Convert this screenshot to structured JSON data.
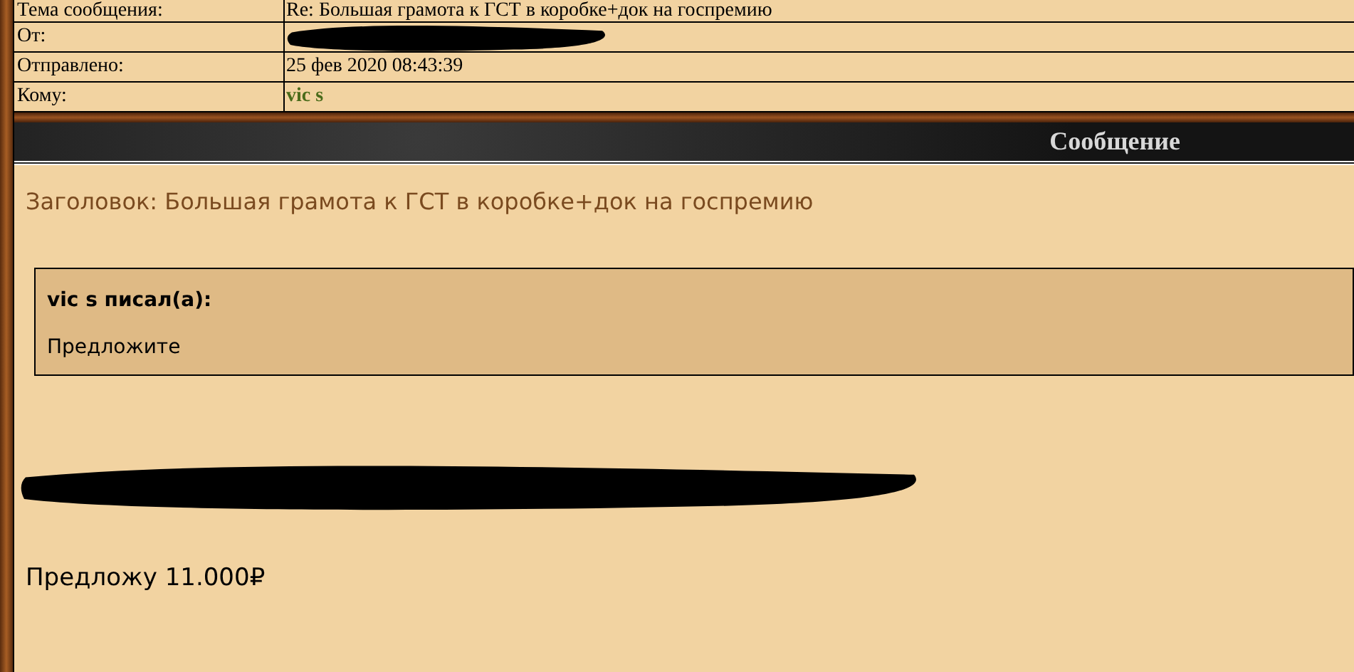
{
  "header_fields": [
    {
      "label": "Тема сообщения:",
      "value": "Re: Большая грамота к ГСТ в коробке+док на госпремию",
      "kind": "text"
    },
    {
      "label": "От:",
      "kind": "redacted"
    },
    {
      "label": "Отправлено:",
      "value": "25 фев 2020 08:43:39",
      "kind": "text"
    },
    {
      "label": "Кому:",
      "value": "vic s",
      "kind": "link"
    }
  ],
  "section_title": "Сообщение",
  "post": {
    "subject": "Заголовок: Большая грамота к ГСТ в коробке+док на госпремию",
    "quote": {
      "author": "vic s писал(а):",
      "text": "Предложите"
    },
    "body": [
      {
        "kind": "redacted"
      },
      {
        "kind": "text",
        "text": "Предложу 11.000₽"
      }
    ]
  }
}
